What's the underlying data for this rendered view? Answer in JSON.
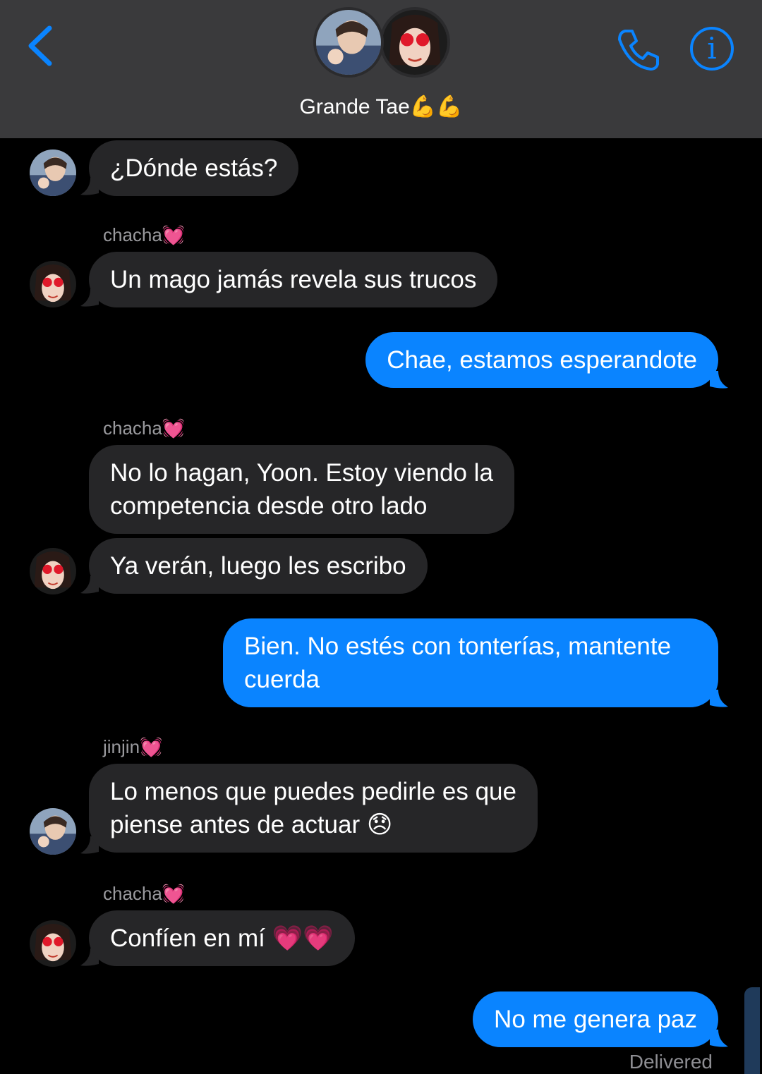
{
  "header": {
    "title": "Grande Tae💪💪",
    "back_icon": "chevron-left-icon",
    "call_icon": "phone-icon",
    "info_icon": "info-icon",
    "info_glyph": "i",
    "accent": "#0a84ff"
  },
  "messages": [
    {
      "id": "m1",
      "direction": "incoming",
      "sender": "",
      "text": "¿Dónde estás?"
    },
    {
      "id": "m2",
      "direction": "incoming",
      "sender": "chacha💓",
      "text": "Un mago jamás revela sus trucos"
    },
    {
      "id": "m3",
      "direction": "outgoing",
      "sender": "",
      "text": "Chae, estamos esperandote"
    },
    {
      "id": "m4",
      "direction": "incoming",
      "sender": "chacha💓",
      "text_line1": "No lo hagan, Yoon. Estoy viendo la",
      "text_line2": "competencia desde otro lado"
    },
    {
      "id": "m5",
      "direction": "incoming",
      "sender": "",
      "text": "Ya verán, luego les escribo"
    },
    {
      "id": "m6",
      "direction": "outgoing",
      "sender": "",
      "text_line1": "Bien. No estés con tonterías, mantente",
      "text_line2": "cuerda"
    },
    {
      "id": "m7",
      "direction": "incoming",
      "sender": "jinjin💓",
      "text_line1": "Lo menos que puedes pedirle es que",
      "text_line2": "piense antes de actuar 😞"
    },
    {
      "id": "m8",
      "direction": "incoming",
      "sender": "chacha💓",
      "text": "Confíen en mí 💗💗"
    },
    {
      "id": "m9",
      "direction": "outgoing",
      "sender": "",
      "text": "No me genera paz"
    }
  ],
  "status": {
    "delivered": "Delivered"
  }
}
